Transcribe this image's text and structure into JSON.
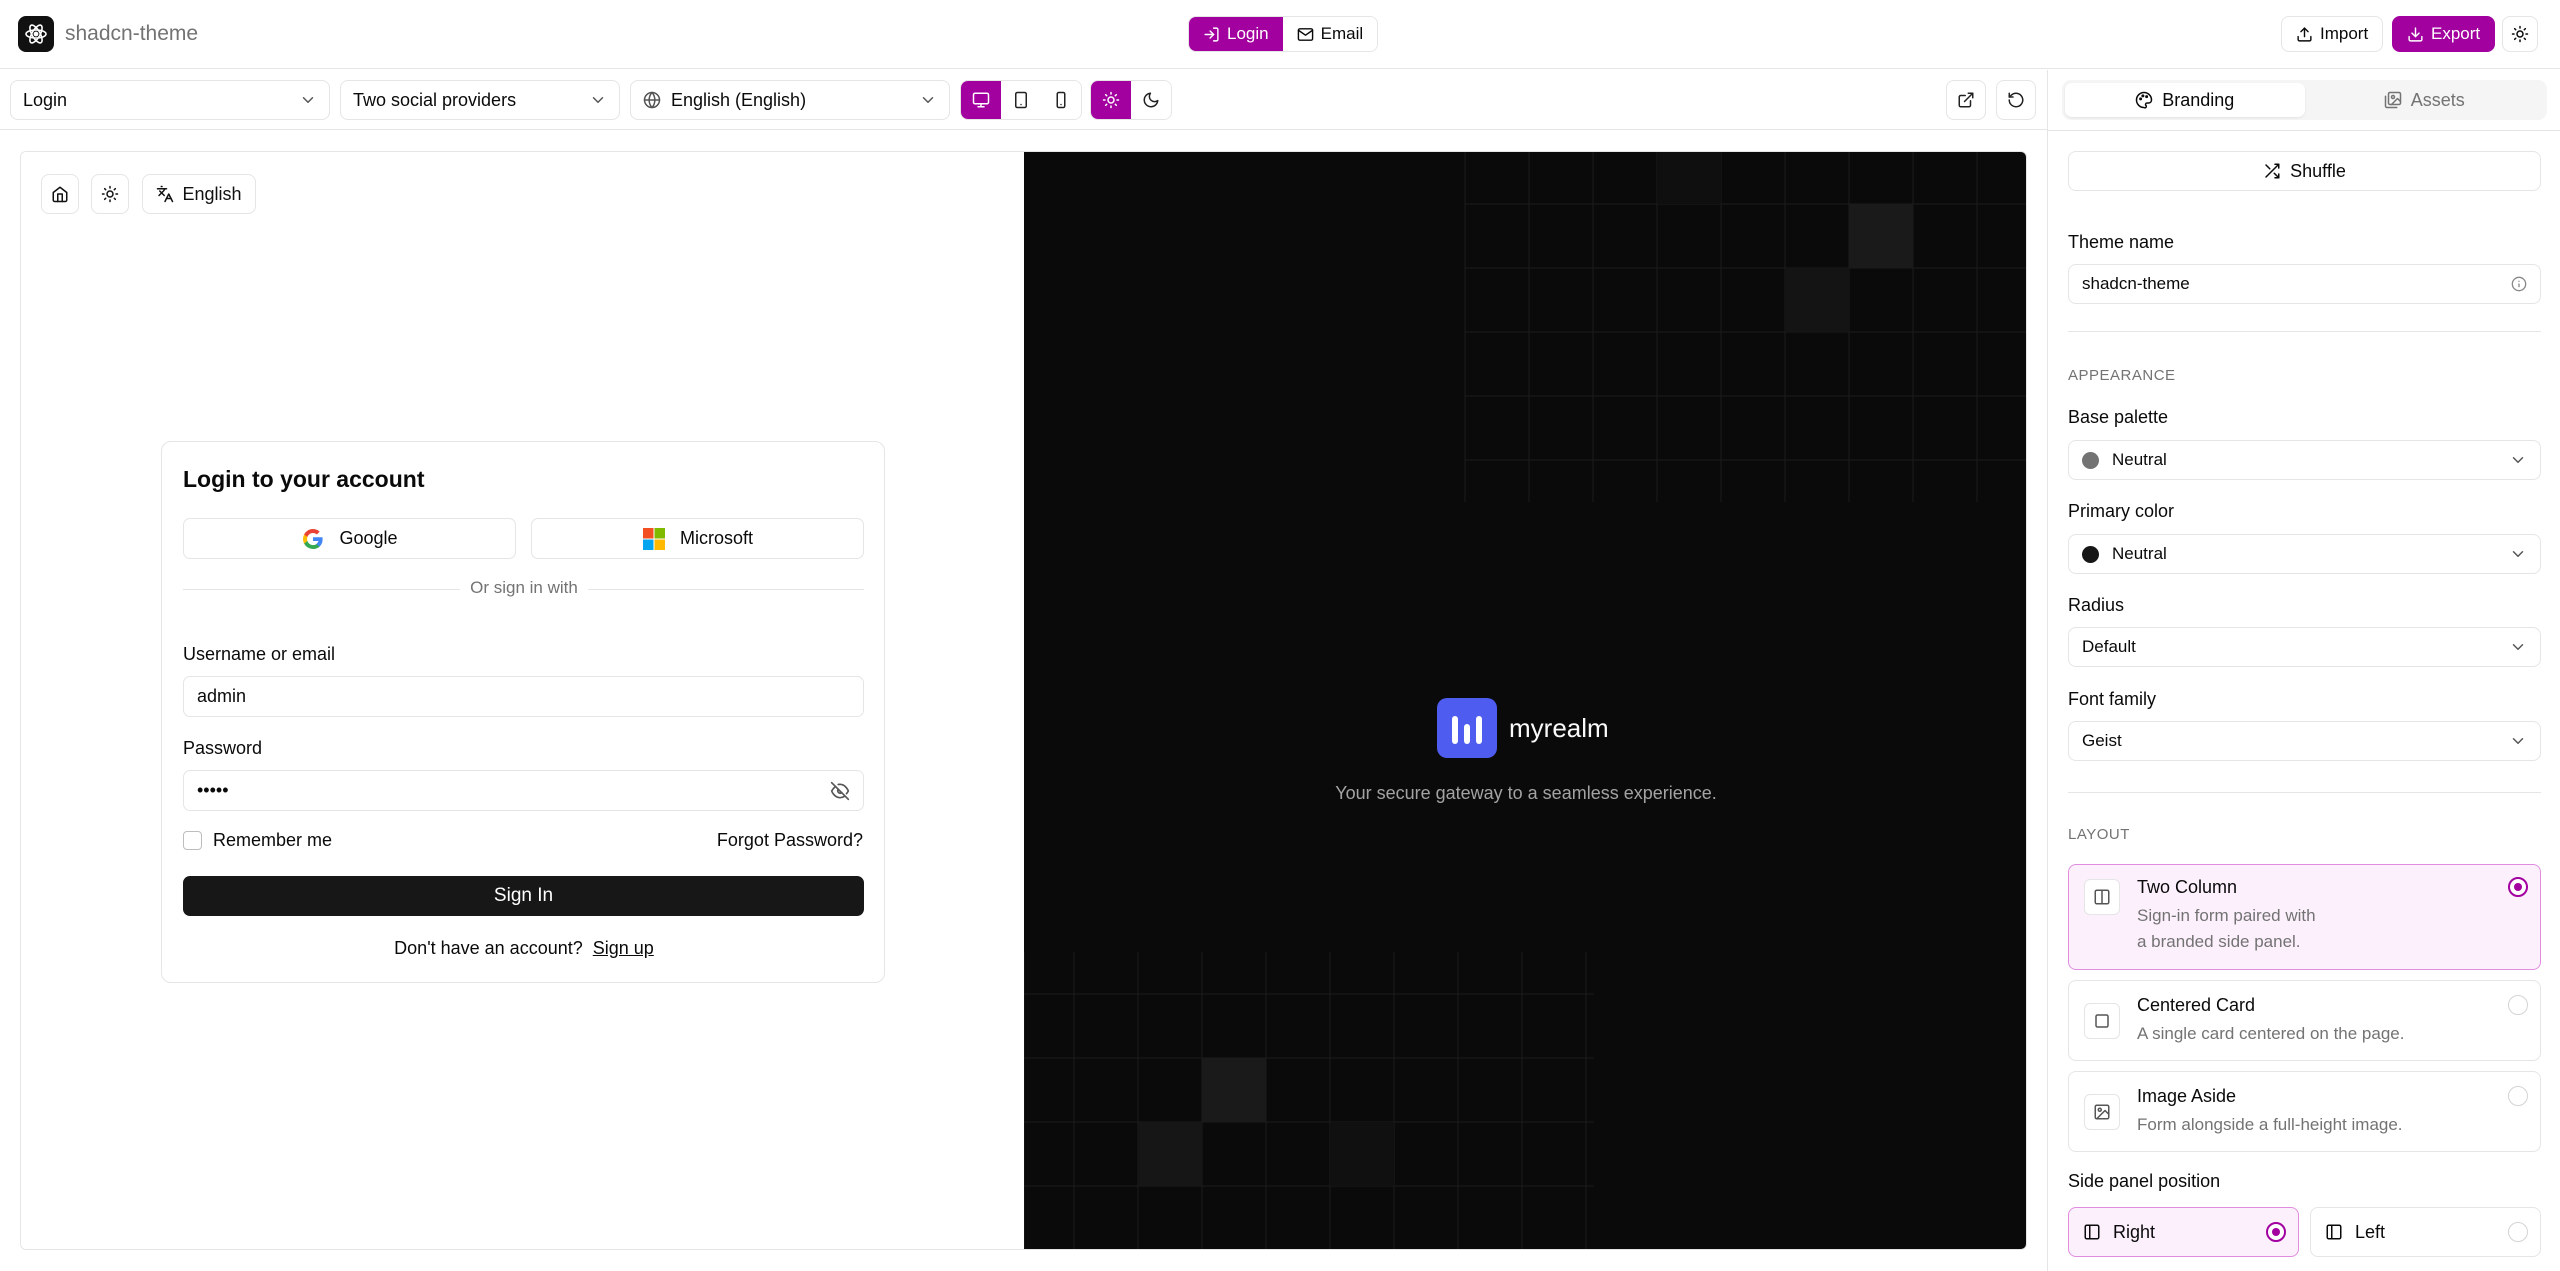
{
  "header": {
    "app_title": "shadcn-theme",
    "mode_tabs": [
      {
        "label": "Login",
        "icon": "login-icon",
        "active": true
      },
      {
        "label": "Email",
        "icon": "mail-icon",
        "active": false
      }
    ],
    "import_label": "Import",
    "export_label": "Export"
  },
  "toolbar": {
    "page_select": "Login",
    "variant_select": "Two social providers",
    "language_select": "English (English)"
  },
  "preview": {
    "locale_label": "English",
    "login_card": {
      "title": "Login to your account",
      "providers": [
        {
          "label": "Google",
          "icon": "google-logo-icon"
        },
        {
          "label": "Microsoft",
          "icon": "microsoft-logo-icon"
        }
      ],
      "divider_text": "Or sign in with",
      "username_label": "Username or email",
      "username_value": "admin",
      "password_label": "Password",
      "password_value": "•••••",
      "remember_label": "Remember me",
      "forgot_label": "Forgot Password?",
      "signin_label": "Sign In",
      "signup_prompt": "Don't have an account?",
      "signup_link": "Sign up"
    },
    "brand_panel": {
      "name": "myrealm",
      "tagline": "Your secure gateway to a seamless experience."
    }
  },
  "panel": {
    "tabs": [
      {
        "label": "Branding",
        "icon": "palette-icon",
        "active": true
      },
      {
        "label": "Assets",
        "icon": "images-icon",
        "active": false
      }
    ],
    "shuffle_label": "Shuffle",
    "theme_name_label": "Theme name",
    "theme_name_value": "shadcn-theme",
    "appearance_heading": "APPEARANCE",
    "base_palette_label": "Base palette",
    "base_palette_value": "Neutral",
    "base_palette_color": "#737373",
    "primary_color_label": "Primary color",
    "primary_color_value": "Neutral",
    "primary_color_color": "#171717",
    "radius_label": "Radius",
    "radius_value": "Default",
    "font_family_label": "Font family",
    "font_family_value": "Geist",
    "layout_heading": "LAYOUT",
    "layouts": [
      {
        "title": "Two Column",
        "desc_line1": "Sign-in form paired with",
        "desc_line2": "a branded side panel.",
        "selected": true
      },
      {
        "title": "Centered Card",
        "desc_line1": "A single card centered on the page.",
        "selected": false
      },
      {
        "title": "Image Aside",
        "desc_line1": "Form alongside a full-height image.",
        "selected": false
      }
    ],
    "side_panel_label": "Side panel position",
    "side_positions": [
      {
        "label": "Right",
        "selected": true
      },
      {
        "label": "Left",
        "selected": false
      }
    ]
  },
  "colors": {
    "accent": "#a2009f",
    "brand_logo": "#4f5cf0",
    "dark_panel": "#0a0a0a"
  }
}
